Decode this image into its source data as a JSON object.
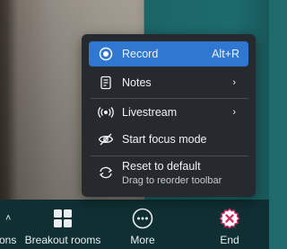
{
  "menu": {
    "items": [
      {
        "label": "Record",
        "shortcut": "Alt+R",
        "icon": "record-icon"
      },
      {
        "label": "Notes",
        "chevron": "›",
        "icon": "notes-icon"
      },
      {
        "label": "Livestream",
        "chevron": "›",
        "icon": "livestream-icon"
      },
      {
        "label": "Start focus mode",
        "icon": "focus-mode-icon"
      },
      {
        "label": "Reset to default",
        "sublabel": "Drag to reorder toolbar",
        "icon": "reset-icon"
      }
    ]
  },
  "toolbar": {
    "left_partial_label": "ons",
    "caret": "˄",
    "breakout_label": "Breakout rooms",
    "more_label": "More",
    "end_label": "End"
  },
  "colors": {
    "accent": "#2f77d0",
    "menu_bg": "#262a2e",
    "toolbar_bg": "#0f2f33",
    "end_icon": "#d6336c"
  }
}
